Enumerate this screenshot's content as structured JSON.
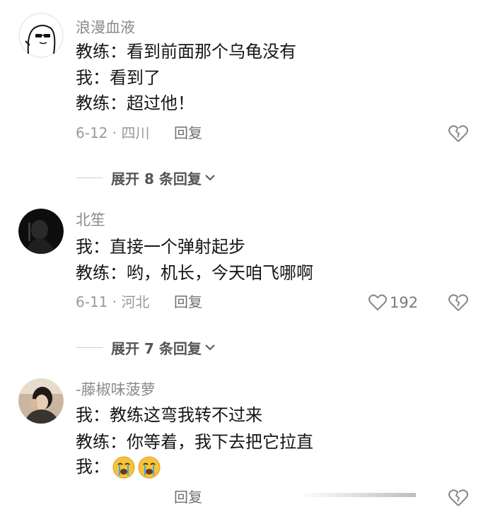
{
  "comments": [
    {
      "username": "浪漫血液",
      "lines": [
        "教练：看到前面那个乌龟没有",
        "我：看到了",
        "教练：超过他！"
      ],
      "meta": "6-12 · 四川",
      "reply_label": "回复",
      "likes": "",
      "expand_label": "展开 8 条回复"
    },
    {
      "username": "北笙",
      "lines": [
        "我：直接一个弹射起步",
        "教练：哟，机长，今天咱飞哪啊"
      ],
      "meta": "6-11 · 河北",
      "reply_label": "回复",
      "likes": "192",
      "expand_label": "展开 7 条回复"
    },
    {
      "username": "-藤椒味菠萝",
      "lines": [
        "我：教练这弯我转不过来",
        "教练：你等着，我下去把它拉直",
        "我："
      ],
      "meta": "",
      "reply_label": "回复",
      "likes": ""
    }
  ],
  "icons": {
    "like": "heart-outline-icon",
    "dislike": "broken-heart-icon",
    "expand": "chevron-down-icon",
    "emoji": "crying-face-emoji"
  },
  "colors": {
    "text": "#161616",
    "muted": "#8a8a8a",
    "emoji": "#f7c23c"
  }
}
